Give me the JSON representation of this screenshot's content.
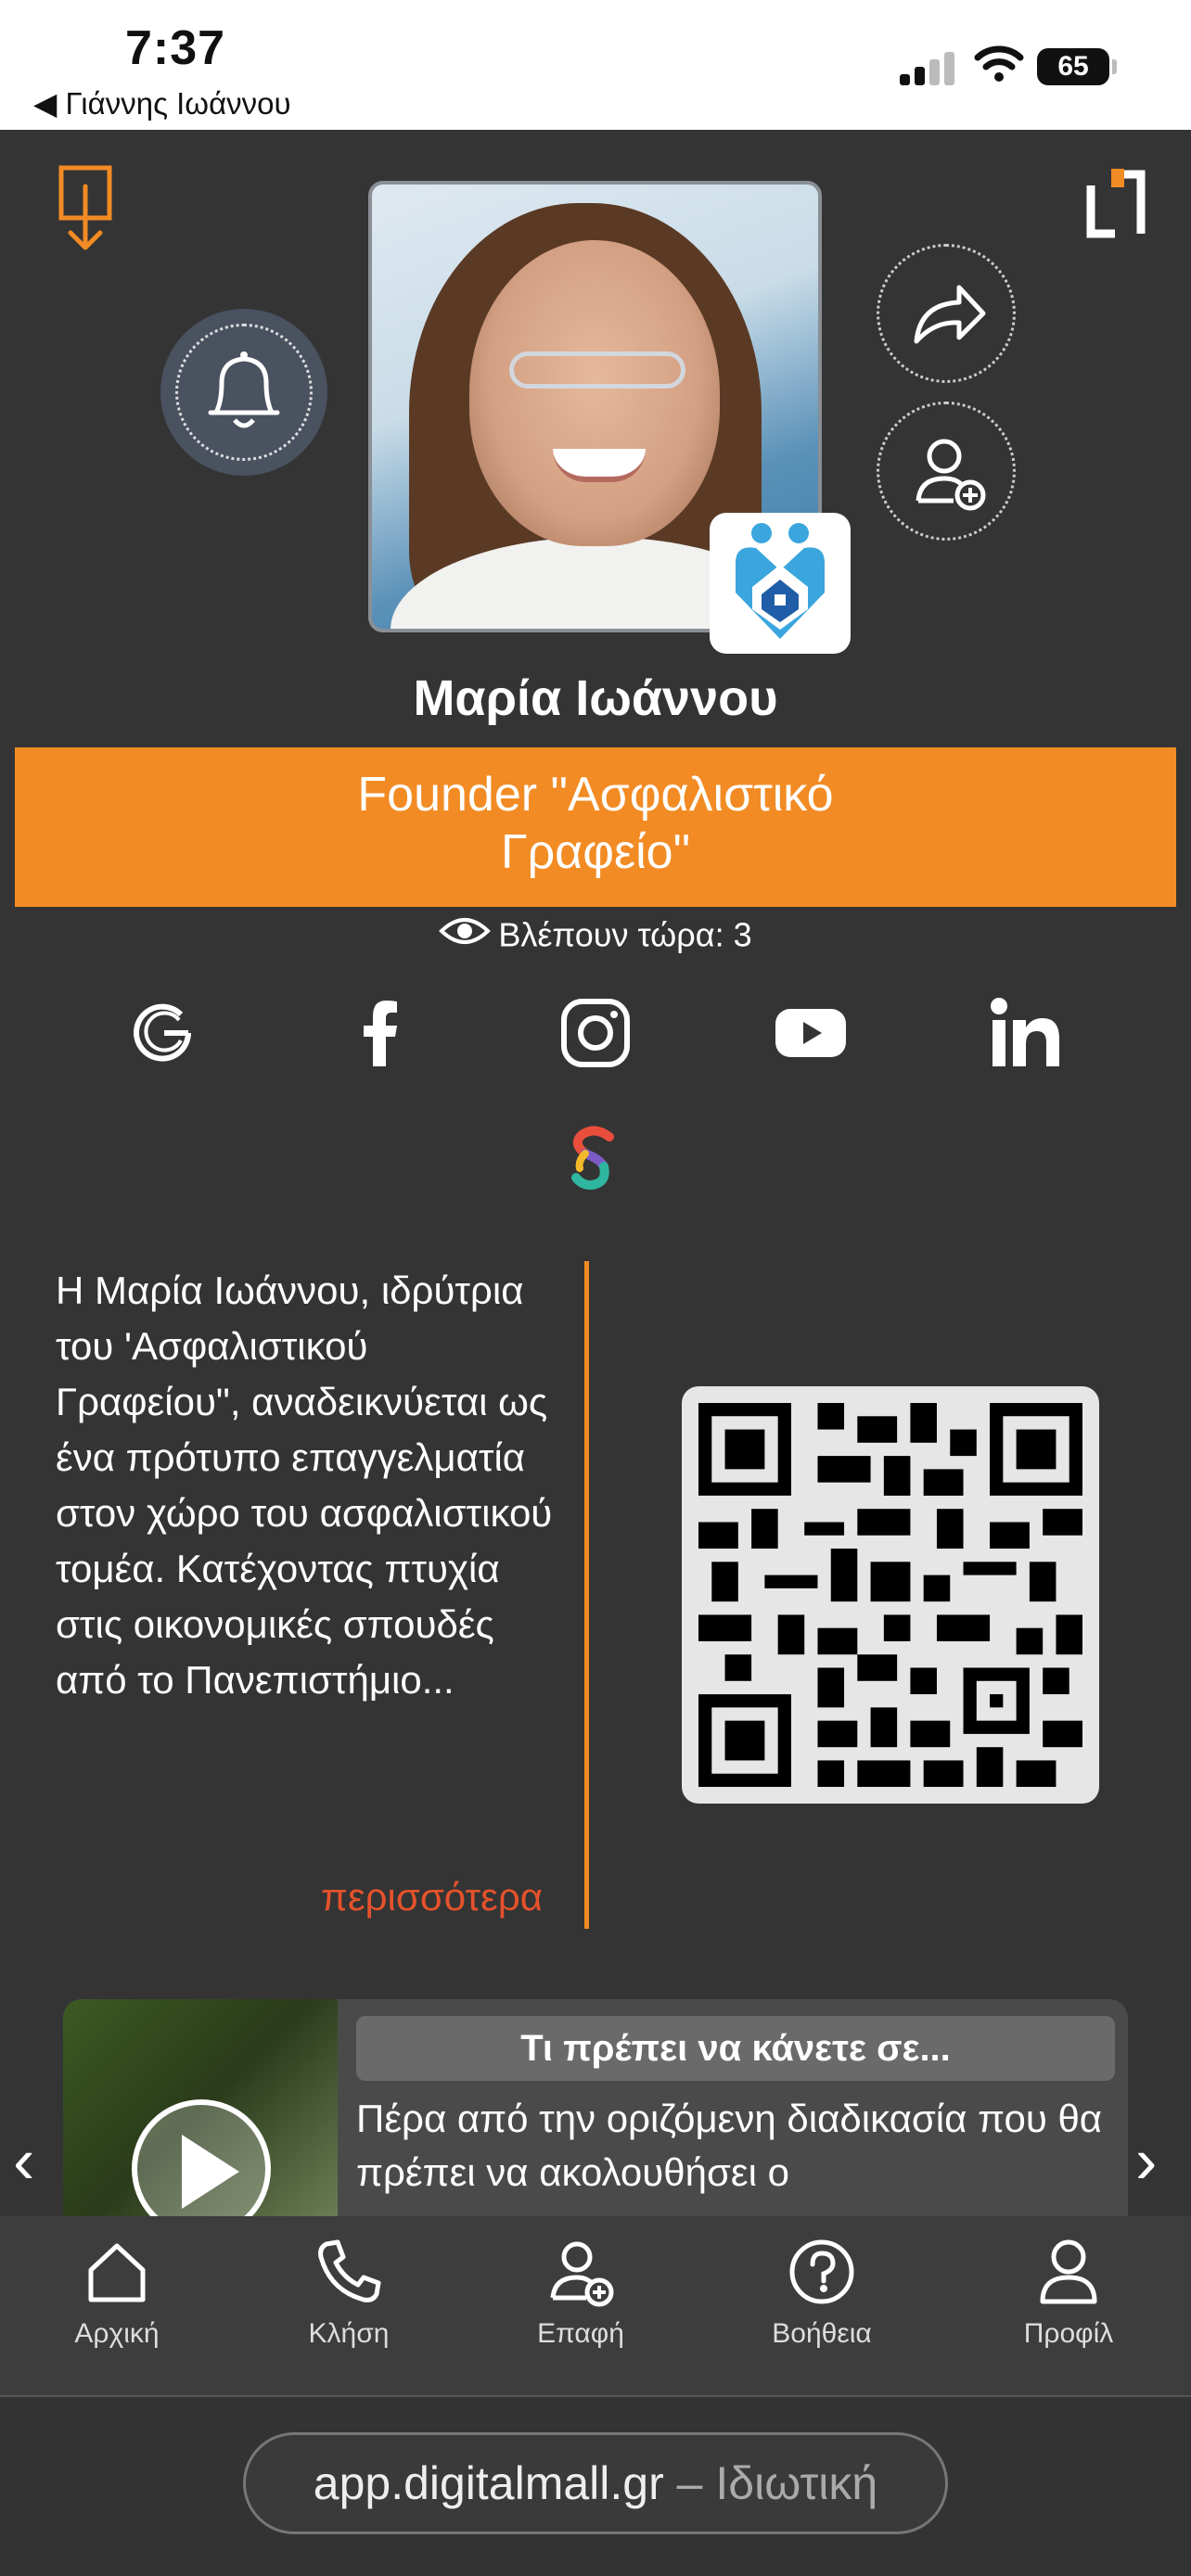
{
  "status_bar": {
    "time": "7:37",
    "back_label": "◀ Γιάννης Ιωάννου",
    "battery": "65"
  },
  "profile": {
    "name": "Μαρία Ιωάννου",
    "title_line1": "Founder \"Ασφαλιστικό",
    "title_line2": "Γραφείο\"",
    "viewers": "Βλέπουν τώρα: 3",
    "colors": {
      "accent": "#f28b24",
      "more_link": "#e5522b",
      "background": "#343434"
    }
  },
  "social_icons": [
    "google-icon",
    "facebook-icon",
    "instagram-icon",
    "youtube-icon",
    "linkedin-icon",
    "s-brand-icon"
  ],
  "bio": {
    "text": "Η Μαρία Ιωάννου, ιδρύτρια του 'Ασφαλιστικού Γραφείου\", αναδεικνύεται ως ένα πρότυπο επαγγελματία στον χώρο του ασφαλιστικού τομέα. Κατέχοντας πτυχία στις οικονομικές σπουδές από το Πανεπιστήμιο...",
    "more_label": "περισσότερα"
  },
  "video_card": {
    "title": "Τι πρέπει να κάνετε σε...",
    "text": "Πέρα από την οριζόμενη διαδικασία που θα πρέπει να ακολουθήσει ο"
  },
  "carousel": {
    "prev": "‹",
    "next": "›"
  },
  "tabbar": {
    "home": "Αρχική",
    "call": "Κλήση",
    "contact": "Επαφή",
    "help": "Βοήθεια",
    "profile": "Προφίλ"
  },
  "browser": {
    "domain": "app.digitalmall.gr",
    "separator": "–",
    "mode": "Ιδιωτική"
  }
}
